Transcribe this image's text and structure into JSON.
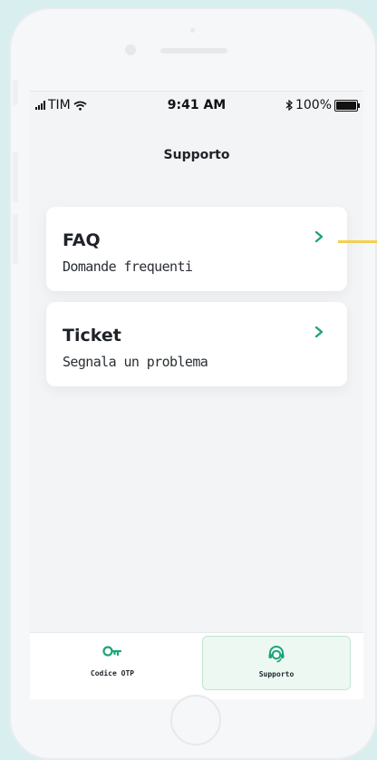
{
  "status_bar": {
    "carrier": "TIM",
    "time": "9:41 AM",
    "battery": "100%"
  },
  "header": {
    "title": "Supporto"
  },
  "cards": [
    {
      "title": "FAQ",
      "subtitle": "Domande frequenti"
    },
    {
      "title": "Ticket",
      "subtitle": "Segnala un problema"
    }
  ],
  "tabbar": {
    "items": [
      {
        "label": "Codice OTP",
        "icon": "key-icon",
        "active": false
      },
      {
        "label": "Supporto",
        "icon": "support-headset-icon",
        "active": true
      }
    ]
  },
  "colors": {
    "accent": "#1fa37a",
    "pointer": "#f4cf4e",
    "active_tab_bg": "#eef8f3"
  }
}
